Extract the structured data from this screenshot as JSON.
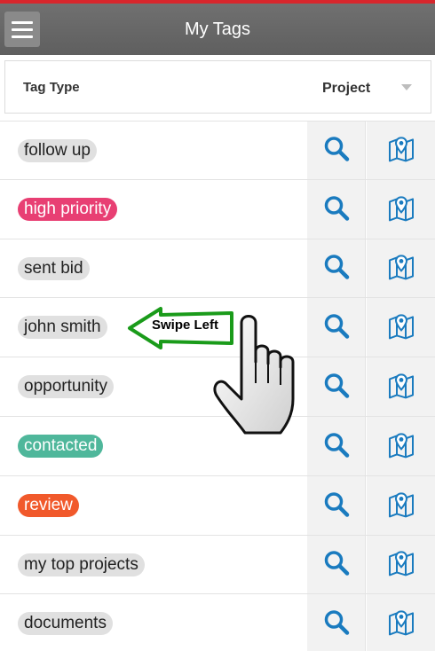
{
  "header": {
    "title": "My Tags",
    "menu_icon": "hamburger-menu-icon"
  },
  "columns": {
    "left": "Tag Type",
    "right": "Project",
    "right_icon": "caret-down-icon"
  },
  "tags": [
    {
      "label": "follow up",
      "color": "#e0e0e0"
    },
    {
      "label": "high priority",
      "color": "#e83f73"
    },
    {
      "label": "sent bid",
      "color": "#e0e0e0"
    },
    {
      "label": "john smith",
      "color": "#e0e0e0"
    },
    {
      "label": "opportunity",
      "color": "#e0e0e0"
    },
    {
      "label": "contacted",
      "color": "#4fb79b"
    },
    {
      "label": "review",
      "color": "#f1592b"
    },
    {
      "label": "my top projects",
      "color": "#e0e0e0"
    },
    {
      "label": "documents",
      "color": "#e0e0e0"
    }
  ],
  "row_actions": {
    "search_icon": "search-icon",
    "map_icon": "map-pin-icon",
    "icon_color": "#1a7bbf"
  },
  "annotation": {
    "text": "Swipe Left",
    "arrow_color": "#1a9b1a",
    "cursor_icon": "hand-pointer-icon"
  },
  "theme": {
    "accent": "#d7262c",
    "app_bar": "#666666"
  }
}
